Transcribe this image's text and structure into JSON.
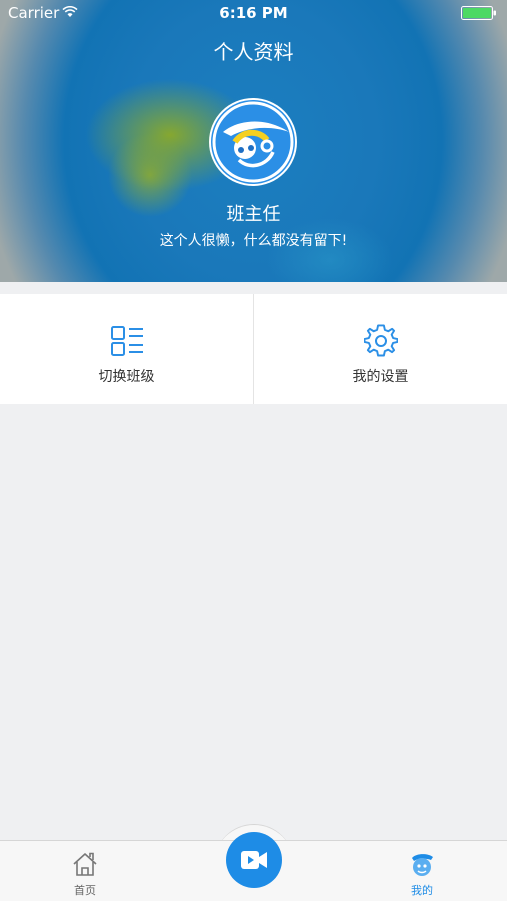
{
  "status_bar": {
    "carrier": "Carrier",
    "time": "6:16 PM"
  },
  "header": {
    "title": "个人资料",
    "user_name": "班主任",
    "signature": "这个人很懒，什么都没有留下!"
  },
  "grid": [
    {
      "label": "切换班级",
      "icon": "class-list-icon"
    },
    {
      "label": "我的设置",
      "icon": "gear-icon"
    }
  ],
  "tab_bar": {
    "home_label": "首页",
    "mine_label": "我的",
    "center_icon": "video-camera-icon"
  },
  "colors": {
    "accent": "#1e8ce6",
    "header_blue": "#1a78ba",
    "battery": "#4cd964",
    "background": "#eff0f2"
  }
}
